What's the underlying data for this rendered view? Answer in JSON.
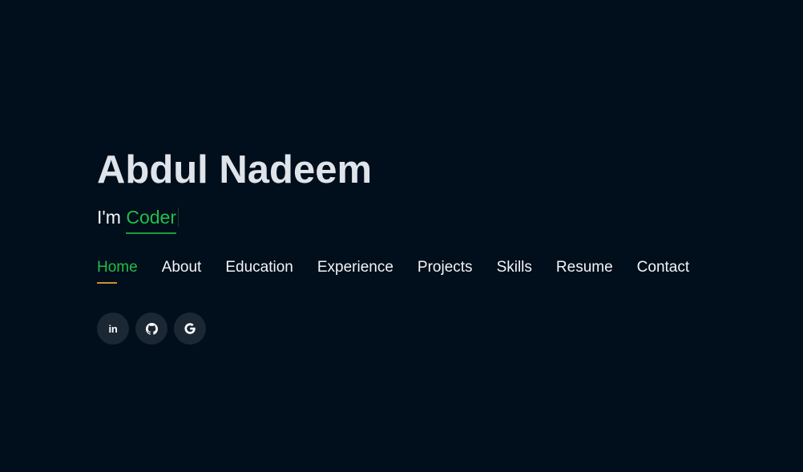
{
  "hero": {
    "name": "Abdul Nadeem",
    "tagline_prefix": "I'm ",
    "role": "Coder"
  },
  "nav": {
    "items": [
      {
        "label": "Home",
        "active": true
      },
      {
        "label": "About",
        "active": false
      },
      {
        "label": "Education",
        "active": false
      },
      {
        "label": "Experience",
        "active": false
      },
      {
        "label": "Projects",
        "active": false
      },
      {
        "label": "Skills",
        "active": false
      },
      {
        "label": "Resume",
        "active": false
      },
      {
        "label": "Contact",
        "active": false
      }
    ]
  },
  "socials": {
    "items": [
      {
        "icon": "linkedin-icon",
        "text": "in"
      },
      {
        "icon": "github-icon"
      },
      {
        "icon": "google-icon"
      }
    ]
  },
  "colors": {
    "background": "#010e1b",
    "accent_green": "#1fbf4a",
    "active_underline": "#c9922f",
    "social_bg": "#1b2733"
  }
}
